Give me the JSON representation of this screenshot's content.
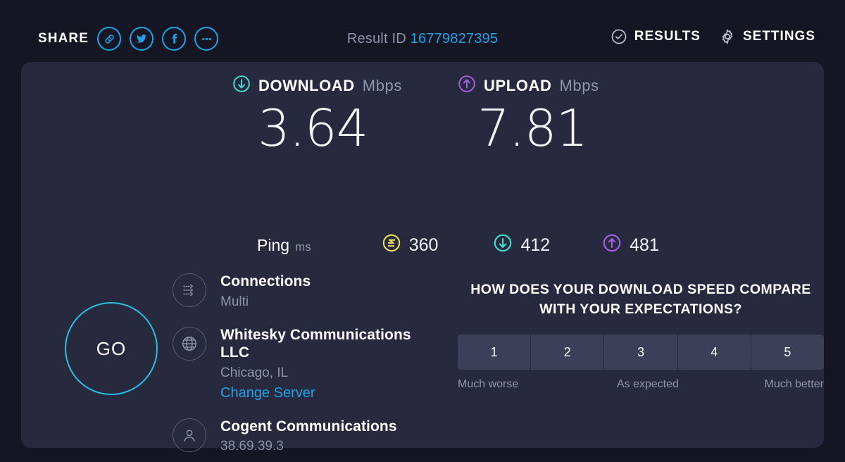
{
  "topbar": {
    "share_label": "SHARE",
    "share_buttons": [
      {
        "name": "link-icon",
        "title": "Copy link"
      },
      {
        "name": "twitter-icon",
        "title": "Share on Twitter"
      },
      {
        "name": "facebook-icon",
        "title": "Share on Facebook"
      },
      {
        "name": "more-icon",
        "title": "More share options"
      }
    ],
    "result_id_label": "Result ID",
    "result_id": "16779827395",
    "results_label": "RESULTS",
    "settings_label": "SETTINGS"
  },
  "speeds": {
    "download": {
      "title": "DOWNLOAD",
      "unit": "Mbps",
      "value": "3.64",
      "color": "#3edfcf",
      "icon": "download-arrow-icon"
    },
    "upload": {
      "title": "UPLOAD",
      "unit": "Mbps",
      "value": "7.81",
      "color": "#a65fe3",
      "icon": "upload-arrow-icon"
    }
  },
  "ping": {
    "label": "Ping",
    "unit": "ms",
    "idle": {
      "value": "360",
      "color": "#e8dd53",
      "icon": "idle-latency-icon"
    },
    "download": {
      "value": "412",
      "color": "#3edfcf",
      "icon": "download-latency-icon"
    },
    "upload": {
      "value": "481",
      "color": "#a65fe3",
      "icon": "upload-latency-icon"
    }
  },
  "go_button": {
    "label": "GO",
    "color": "#29bfe0"
  },
  "info": {
    "connections": {
      "title": "Connections",
      "value": "Multi",
      "icon": "multi-connection-icon"
    },
    "server": {
      "title": "Whitesky Communications LLC",
      "location": "Chicago, IL",
      "change_link": "Change Server",
      "icon": "globe-icon"
    },
    "isp": {
      "title": "Cogent Communications",
      "ip": "38.69.39.3",
      "icon": "person-icon"
    }
  },
  "survey": {
    "question_line1": "HOW DOES YOUR DOWNLOAD SPEED COMPARE",
    "question_line2": "WITH YOUR EXPECTATIONS?",
    "options": [
      "1",
      "2",
      "3",
      "4",
      "5"
    ],
    "label_low": "Much worse",
    "label_mid": "As expected",
    "label_high": "Much better"
  }
}
